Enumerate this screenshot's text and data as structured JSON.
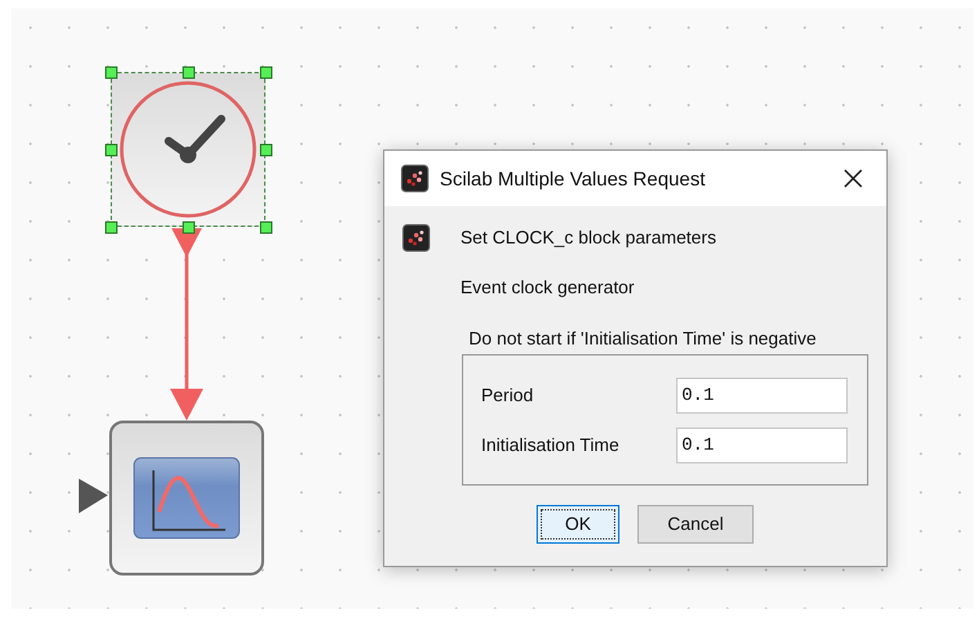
{
  "diagram": {
    "blocks": [
      {
        "kind": "clock",
        "selected": true
      },
      {
        "kind": "scope",
        "selected": false
      }
    ]
  },
  "dialog": {
    "title": "Scilab Multiple Values Request",
    "heading": "Set CLOCK_c block parameters",
    "description": "Event clock generator",
    "group_label": "Do not start if 'Initialisation Time' is negative",
    "fields": [
      {
        "label": "Period",
        "value": "0.1"
      },
      {
        "label": "Initialisation Time",
        "value": "0.1"
      }
    ],
    "buttons": [
      {
        "label": "OK",
        "focused": true
      },
      {
        "label": "Cancel",
        "focused": false
      }
    ]
  }
}
